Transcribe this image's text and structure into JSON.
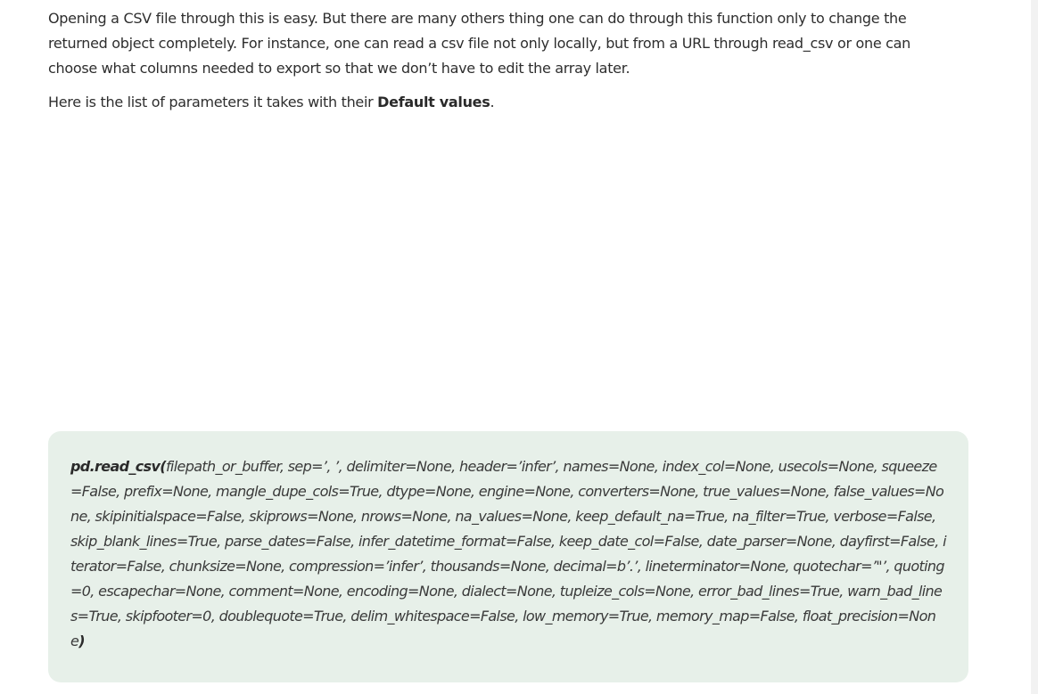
{
  "article": {
    "paragraph1": "Opening a CSV file through this is easy. But there are many others thing one can do through this function only to change the returned object completely. For instance, one can read a csv file not only locally, but from a URL through read_csv or one can choose what columns needed to export so that we don’t have to edit the array later.",
    "paragraph2_before": "Here is the list of parameters it takes with their ",
    "paragraph2_bold": "Default values",
    "paragraph2_after": "."
  },
  "code_block": {
    "function_name": "pd.read_csv(",
    "parameters": "filepath_or_buffer, sep=’, ’, delimiter=None, header=’infer’, names=None, index_col=None, usecols=None, squeeze=False, prefix=None, mangle_dupe_cols=True, dtype=None, engine=None, converters=None, true_values=None, false_values=None, skipinitialspace=False, skiprows=None, nrows=None, na_values=None, keep_default_na=True, na_filter=True, verbose=False, skip_blank_lines=True, parse_dates=False, infer_datetime_format=False, keep_date_col=False, date_parser=None, dayfirst=False, iterator=False, chunksize=None, compression=’infer’, thousands=None, decimal=b’.’, lineterminator=None, quotechar=’\"’, quoting=0, escapechar=None, comment=None, encoding=None, dialect=None, tupleize_cols=None, error_bad_lines=True, warn_bad_lines=True, skipfooter=0, doublequote=True, delim_whitespace=False, low_memory=True, memory_map=False, float_precision=None",
    "closing": ")"
  },
  "colors": {
    "code_background": "#e7f0e9",
    "text": "#2e2e2e"
  }
}
